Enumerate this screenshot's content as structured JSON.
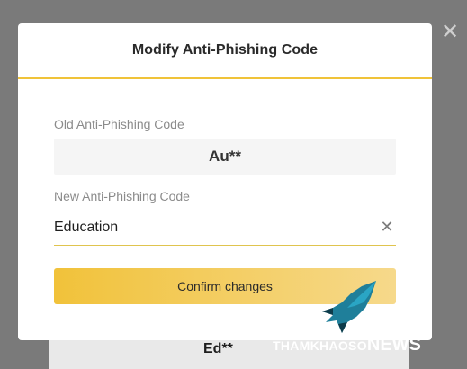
{
  "modal": {
    "title": "Modify Anti-Phishing Code",
    "old_label": "Old Anti-Phishing Code",
    "old_value": "Au**",
    "new_label": "New Anti-Phishing Code",
    "new_value": "Education",
    "confirm_label": "Confirm changes"
  },
  "background": {
    "masked_code": "Ed**"
  },
  "watermark": {
    "part1": "THAMKHAOSO",
    "part2": "NEWS"
  },
  "colors": {
    "accent": "#f0c339",
    "overlay": "#7a7a7a"
  }
}
